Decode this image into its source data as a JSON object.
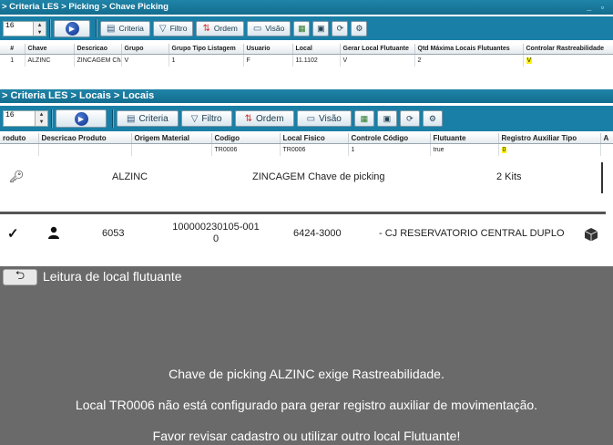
{
  "window1": {
    "breadcrumb": "> Criteria LES > Picking > Chave Picking",
    "controls": "_ ▫",
    "page_size": "16",
    "toolbar": {
      "criteria": "Criteria",
      "filtro": "Filtro",
      "ordem": "Ordem",
      "visao": "Visão"
    },
    "columns": [
      "#",
      "Chave",
      "Descricao",
      "Grupo",
      "Grupo Tipo Listagem",
      "Usuario",
      "Local",
      "Gerar Local Flutuante",
      "Qtd Máxima Locais Flutuantes",
      "Controlar Rastreabilidade"
    ],
    "row": [
      "1",
      "ALZINC",
      "ZINCAGEM Cha",
      "V",
      "1",
      "F",
      "11.1102",
      "V",
      "2",
      "V"
    ]
  },
  "window2": {
    "breadcrumb": "> Criteria LES > Locais > Locais",
    "page_size": "16",
    "toolbar": {
      "criteria": "Criteria",
      "filtro": "Filtro",
      "ordem": "Ordem",
      "visao": "Visão"
    },
    "columns": [
      "roduto",
      "Descricao Produto",
      "Origem Material",
      "Codigo",
      "Local Fisico",
      "Controle Código",
      "Flutuante",
      "Registro Auxiliar Tipo",
      "A"
    ],
    "row": [
      "",
      "",
      "",
      "TR0006",
      "TR0006",
      "1",
      "true",
      "0",
      ""
    ]
  },
  "picking_key": {
    "code": "ALZINC",
    "description": "ZINCAGEM Chave de picking",
    "quantity": "2 Kits"
  },
  "item": {
    "number": "6053",
    "id_line1": "100000230105-001",
    "id_line2": "0",
    "location": "6424-3000",
    "description": "- CJ RESERVATORIO CENTRAL DUPLO"
  },
  "overlay": {
    "title": "Leitura de local flutuante",
    "messages": [
      "Chave de picking ALZINC exige Rastreabilidade.",
      "Local TR0006 não está configurado para gerar registro auxiliar de movimentação.",
      "Favor revisar cadastro ou utilizar outro local Flutuante!"
    ]
  },
  "icons": {
    "run": "play-icon",
    "criteria": "criteria-icon",
    "filtro": "filter-icon",
    "ordem": "sort-icon",
    "visao": "view-icon",
    "key": "key-icon",
    "check": "check-icon",
    "user": "user-icon",
    "box": "box-icon",
    "back": "back-arrow-icon"
  }
}
